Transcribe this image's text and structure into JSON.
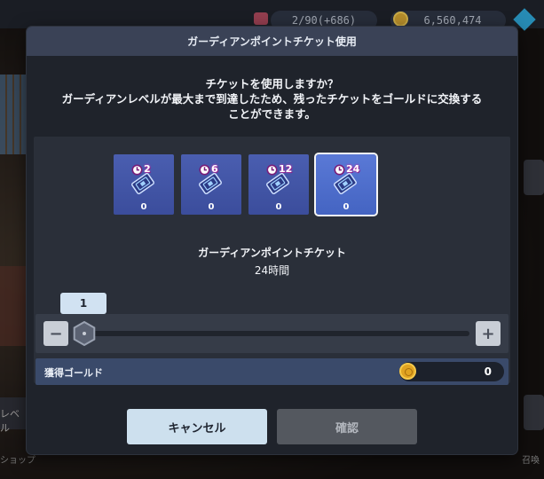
{
  "background": {
    "left_label": "レベル",
    "bottom_left_text": "ショップ",
    "bottom_right_text": "召喚"
  },
  "top_bar": {
    "ticket_count": "2/90(+686)",
    "gold_amount": "6,560,474"
  },
  "dialog": {
    "title": "ガーディアンポイントチケット使用",
    "message_line1": "チケットを使用しますか？",
    "message_line2": "ガーディアンレベルが最大まで到達したため、残ったチケットをゴールドに交換する",
    "message_line3": "ことができます。",
    "tickets": [
      {
        "badge": "2",
        "count": "0",
        "selected": false
      },
      {
        "badge": "6",
        "count": "0",
        "selected": false
      },
      {
        "badge": "12",
        "count": "0",
        "selected": false
      },
      {
        "badge": "24",
        "count": "0",
        "selected": true
      }
    ],
    "ticket_name": "ガーディアンポイントチケット",
    "ticket_duration": "24時間",
    "slider": {
      "value": "1",
      "minus_label": "−",
      "plus_label": "+"
    },
    "gold_row": {
      "label": "獲得ゴールド",
      "value": "0"
    },
    "buttons": {
      "cancel": "キャンセル",
      "confirm": "確認"
    }
  },
  "colors": {
    "header": "#3a4256",
    "ticket": "#3b4d9c",
    "ticket_selected": "#4464c2",
    "cancel_button": "#cde0ee",
    "confirm_button_disabled": "#54585f",
    "gold": "#e0a321"
  }
}
